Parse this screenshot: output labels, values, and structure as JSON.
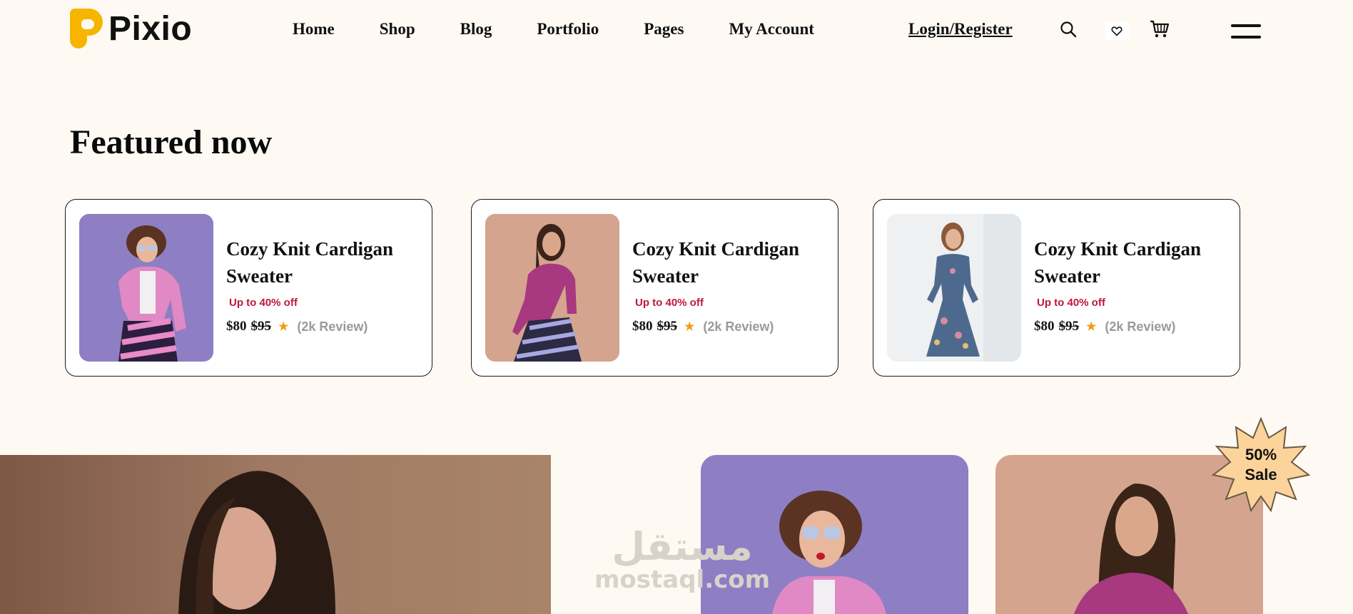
{
  "brand": {
    "name": "Pixio",
    "color": "#f7b500"
  },
  "nav": {
    "items": [
      "Home",
      "Shop",
      "Blog",
      "Portfolio",
      "Pages",
      "My Account"
    ],
    "login_label": "Login/Register"
  },
  "header_icons": [
    "search-icon",
    "heart-icon",
    "cart-icon",
    "hamburger-menu-icon"
  ],
  "featured": {
    "title": "Featured now",
    "cards": [
      {
        "name": "Cozy Knit Cardigan Sweater",
        "discount": "Up to 40% off",
        "price": "$80",
        "old_price": "$95",
        "star": "★",
        "reviews": "(2k Review)",
        "photo_bg": "#8e7ec4"
      },
      {
        "name": "Cozy Knit Cardigan Sweater",
        "discount": "Up to 40% off",
        "price": "$80",
        "old_price": "$95",
        "star": "★",
        "reviews": "(2k Review)",
        "photo_bg": "#d4a48f"
      },
      {
        "name": "Cozy Knit Cardigan Sweater",
        "discount": "Up to 40% off",
        "price": "$80",
        "old_price": "$95",
        "star": "★",
        "reviews": "(2k Review)",
        "photo_bg": "#eef0f2"
      }
    ]
  },
  "sale_badge": {
    "line1": "50%",
    "line2": "Sale",
    "color": "#fcd39a"
  },
  "watermark": {
    "arabic": "مستقل",
    "latin": "mostaql.com"
  },
  "colors": {
    "background": "#fef9f3",
    "discount": "#c0163c",
    "star": "#f39c12",
    "review": "#9a9a9a"
  }
}
